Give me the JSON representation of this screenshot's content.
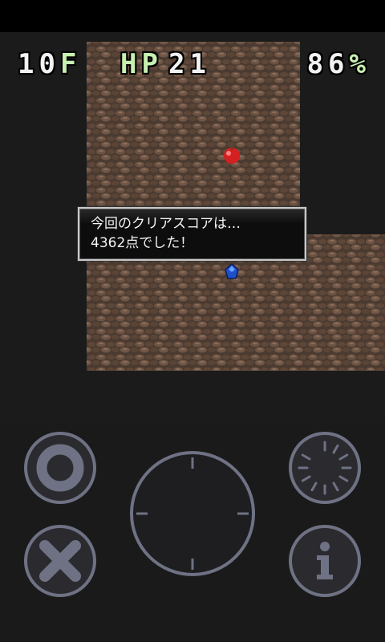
{
  "hud": {
    "floor_value": "10",
    "floor_unit": "F",
    "hp_label": "HP",
    "hp_value": "21",
    "fullness_value": "86",
    "fullness_unit": "%"
  },
  "message": {
    "line1": "今回のクリアスコアは…",
    "line2": "4362点でした！"
  },
  "controls": {
    "confirm_icon": "circle-icon",
    "cancel_icon": "x-icon",
    "wait_icon": "clock-icon",
    "info_icon": "info-icon",
    "dpad_icon": "dpad-ring"
  },
  "items": {
    "apple_icon": "apple-icon",
    "player_icon": "blue-gem-icon"
  },
  "colors": {
    "dungeon_floor": "#5c4436",
    "hud_green": "#c8f0b0",
    "control_outline": "#6e7284"
  }
}
